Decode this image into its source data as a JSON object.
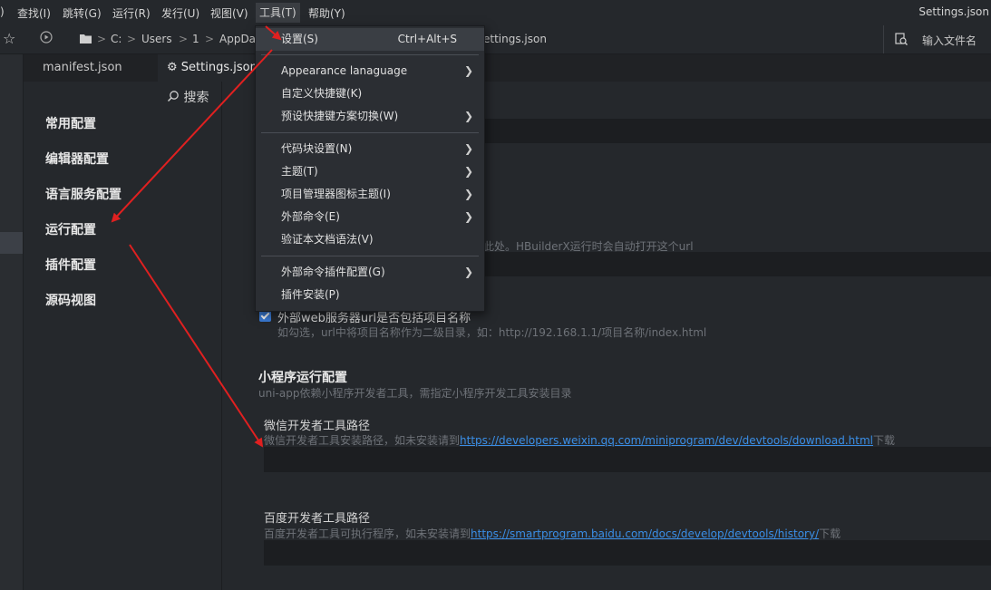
{
  "menubar": {
    "items": [
      ")",
      "查找(I)",
      "跳转(G)",
      "运行(R)",
      "发行(U)",
      "视图(V)",
      "工具(T)",
      "帮助(Y)"
    ],
    "window_title": "Settings.json"
  },
  "toolbar": {
    "breadcrumb": [
      "C:",
      "Users",
      "1",
      "AppDa"
    ],
    "breadcrumb_tail": "ettings.json",
    "file_input_placeholder": "输入文件名"
  },
  "tabs": [
    {
      "label": "manifest.json"
    },
    {
      "label": "Settings.json"
    }
  ],
  "settings_nav": {
    "search_label": "搜索",
    "items": [
      "常用配置",
      "编辑器配置",
      "语言服务配置",
      "运行配置",
      "插件配置",
      "源码视图"
    ]
  },
  "tools_menu": {
    "items": [
      {
        "label": "设置(S)",
        "shortcut": "Ctrl+Alt+S",
        "submenu": false
      },
      {
        "label": "Appearance lanaguage",
        "shortcut": "",
        "submenu": true
      },
      {
        "label": "自定义快捷键(K)",
        "shortcut": "",
        "submenu": false
      },
      {
        "label": "预设快捷键方案切换(W)",
        "shortcut": "",
        "submenu": true
      },
      {
        "label": "代码块设置(N)",
        "shortcut": "",
        "submenu": true
      },
      {
        "label": "主题(T)",
        "shortcut": "",
        "submenu": true
      },
      {
        "label": "项目管理器图标主题(I)",
        "shortcut": "",
        "submenu": true
      },
      {
        "label": "外部命令(E)",
        "shortcut": "",
        "submenu": true
      },
      {
        "label": "验证本文档语法(V)",
        "shortcut": "",
        "submenu": false
      },
      {
        "label": "外部命令插件配置(G)",
        "shortcut": "",
        "submenu": true
      },
      {
        "label": "插件安装(P)",
        "shortcut": "",
        "submenu": false
      }
    ]
  },
  "content": {
    "partial_hint": "此处。HBuilderX运行时会自动打开这个url",
    "checkbox_label": "外部web服务器url是否包括项目名称",
    "checkbox_checked": true,
    "checkbox_hint": "如勾选，url中将项目名称作为二级目录，如：http://192.168.1.1/项目名称/index.html",
    "mini_section_title": "小程序运行配置",
    "mini_section_hint": "uni-app依赖小程序开发者工具，需指定小程序开发工具安装目录",
    "wechat_label": "微信开发者工具路径",
    "wechat_hint_prefix": "微信开发者工具安装路径，如未安装请到",
    "wechat_link": "https://developers.weixin.qq.com/miniprogram/dev/devtools/download.html",
    "wechat_hint_suffix": "下载",
    "baidu_label": "百度开发者工具路径",
    "baidu_hint_prefix": "百度开发者工具可执行程序，如未安装请到",
    "baidu_link": "https://smartprogram.baidu.com/docs/develop/devtools/history/",
    "baidu_hint_suffix": "下载"
  },
  "colors": {
    "background": "#25282c",
    "menu_background": "#2b2e33",
    "link": "#3a8ee6",
    "annotation_arrow": "#e02020",
    "checkbox": "#3a7bd5"
  }
}
